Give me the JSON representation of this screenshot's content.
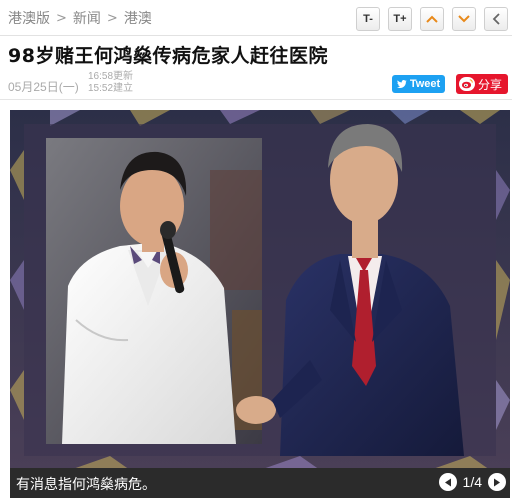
{
  "breadcrumb": {
    "items": [
      "港澳版",
      "新闻",
      "港澳"
    ],
    "separator": ">"
  },
  "toolbar": {
    "font_smaller": "T-",
    "font_larger": "T+",
    "up_icon": "chevron-up-icon",
    "down_icon": "chevron-down-icon",
    "back_icon": "chevron-left-icon",
    "accent": "#e8891a"
  },
  "article": {
    "title": "98岁赌王何鸿燊传病危家人赶往医院",
    "date": "05月25日(一)",
    "updated": "16:58更新",
    "created": "15:52建立"
  },
  "social": {
    "tweet_label": "Tweet",
    "share_label": "分享",
    "tweet_color": "#1da1f2",
    "share_color": "#e6162d"
  },
  "gallery": {
    "caption": "有消息指何鸿燊病危。",
    "pager": "1/4"
  }
}
